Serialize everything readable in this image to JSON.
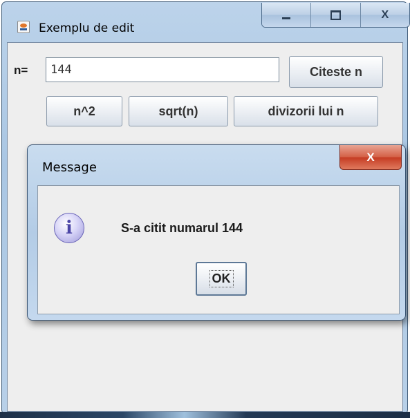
{
  "window": {
    "title": "Exemplu de edit",
    "controls": {
      "minimize": "",
      "maximize": "",
      "close": "X"
    }
  },
  "form": {
    "n_label": "n=",
    "n_value": "144",
    "citeste_button": "Citeste n",
    "buttons": [
      "n^2",
      "sqrt(n)",
      "divizorii lui n"
    ]
  },
  "dialog": {
    "title": "Message",
    "close": "X",
    "icon": "information-icon",
    "icon_glyph": "i",
    "message": "S-a citit numarul 144",
    "ok_label": "OK"
  }
}
